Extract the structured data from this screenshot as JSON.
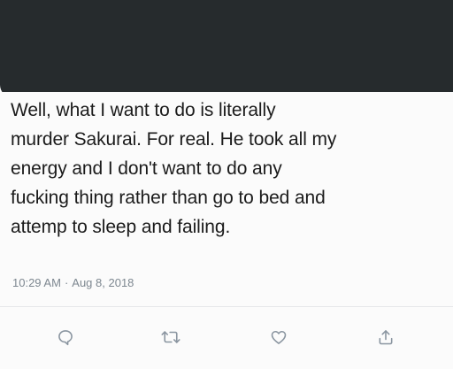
{
  "tweet": {
    "lines": [
      "Well, what I want to do is literally",
      "murder Sakurai. For real. He took all my",
      "energy and I don't want to do any",
      "fucking thing rather than go to bed and",
      "attemp to sleep and failing."
    ],
    "time": "10:29 AM",
    "separator": "·",
    "date": "Aug 8, 2018"
  },
  "actions": [
    "reply-icon",
    "retweet-icon",
    "like-icon",
    "share-icon"
  ],
  "colors": {
    "redaction": "#262b2d",
    "text": "#1b1b1b",
    "meta": "#7d8790",
    "icon": "#8a95a0"
  }
}
